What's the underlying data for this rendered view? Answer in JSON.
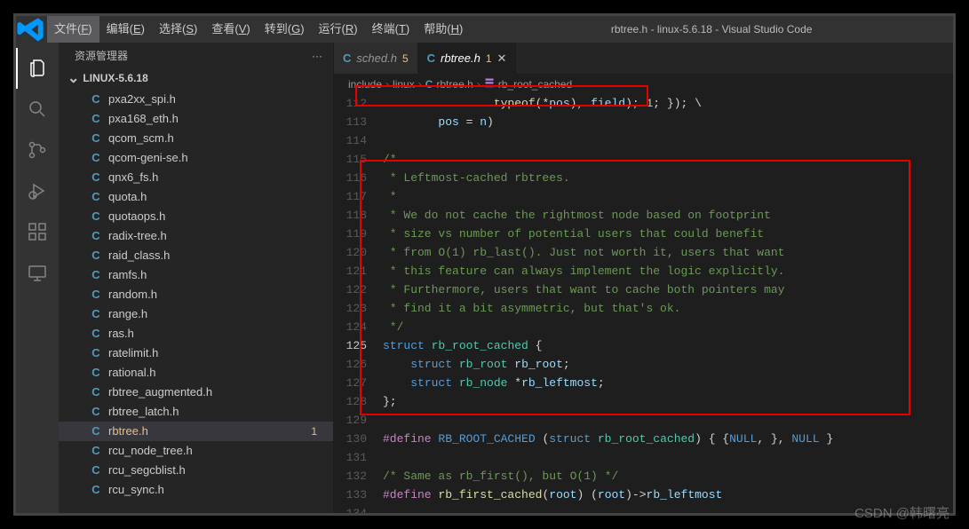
{
  "window_title": "rbtree.h - linux-5.6.18 - Visual Studio Code",
  "menubar": [
    {
      "label": "文件",
      "key": "F"
    },
    {
      "label": "编辑",
      "key": "E"
    },
    {
      "label": "选择",
      "key": "S"
    },
    {
      "label": "查看",
      "key": "V"
    },
    {
      "label": "转到",
      "key": "G"
    },
    {
      "label": "运行",
      "key": "R"
    },
    {
      "label": "终端",
      "key": "T"
    },
    {
      "label": "帮助",
      "key": "H"
    }
  ],
  "sidebar": {
    "title": "资源管理器",
    "folder": "LINUX-5.6.18",
    "more": "···",
    "files": [
      {
        "name": "pxa2xx_spi.h"
      },
      {
        "name": "pxa168_eth.h"
      },
      {
        "name": "qcom_scm.h"
      },
      {
        "name": "qcom-geni-se.h"
      },
      {
        "name": "qnx6_fs.h"
      },
      {
        "name": "quota.h"
      },
      {
        "name": "quotaops.h"
      },
      {
        "name": "radix-tree.h"
      },
      {
        "name": "raid_class.h"
      },
      {
        "name": "ramfs.h"
      },
      {
        "name": "random.h"
      },
      {
        "name": "range.h"
      },
      {
        "name": "ras.h"
      },
      {
        "name": "ratelimit.h"
      },
      {
        "name": "rational.h"
      },
      {
        "name": "rbtree_augmented.h"
      },
      {
        "name": "rbtree_latch.h"
      },
      {
        "name": "rbtree.h",
        "active": true,
        "badge": "1"
      },
      {
        "name": "rcu_node_tree.h"
      },
      {
        "name": "rcu_segcblist.h"
      },
      {
        "name": "rcu_sync.h"
      }
    ]
  },
  "tabs": [
    {
      "label": "sched.h",
      "badge": "5"
    },
    {
      "label": "rbtree.h",
      "badge": "1",
      "active": true
    }
  ],
  "breadcrumb": {
    "parts": [
      "include",
      "linux"
    ],
    "file": "rbtree.h",
    "symbol": "rb_root_cached"
  },
  "code": {
    "start": 112,
    "current": 125,
    "lines": [
      {
        "n": 112,
        "html": "                <span class='tok-func'>typeof</span>(*<span class='tok-var'>pos</span>), <span class='tok-var'>field</span>); <span class='tok-num'>1</span>; }); \\"
      },
      {
        "n": 113,
        "html": "        <span class='tok-var'>pos</span> = <span class='tok-var'>n</span>)"
      },
      {
        "n": 114,
        "html": ""
      },
      {
        "n": 115,
        "html": "<span class='tok-comment'>/*</span>"
      },
      {
        "n": 116,
        "html": "<span class='tok-comment'> * Leftmost-cached rbtrees.</span>"
      },
      {
        "n": 117,
        "html": "<span class='tok-comment'> *</span>"
      },
      {
        "n": 118,
        "html": "<span class='tok-comment'> * We do not cache the rightmost node based on footprint</span>"
      },
      {
        "n": 119,
        "html": "<span class='tok-comment'> * size vs number of potential users that could benefit</span>"
      },
      {
        "n": 120,
        "html": "<span class='tok-comment'> * from O(1) rb_last(). Just not worth it, users that want</span>"
      },
      {
        "n": 121,
        "html": "<span class='tok-comment'> * this feature can always implement the logic explicitly.</span>"
      },
      {
        "n": 122,
        "html": "<span class='tok-comment'> * Furthermore, users that want to cache both pointers may</span>"
      },
      {
        "n": 123,
        "html": "<span class='tok-comment'> * find it a bit asymmetric, but that's ok.</span>"
      },
      {
        "n": 124,
        "html": "<span class='tok-comment'> */</span>"
      },
      {
        "n": 125,
        "html": "<span class='tok-kw'>struct</span> <span class='tok-type'>rb_root_cached</span> {"
      },
      {
        "n": 126,
        "html": "    <span class='tok-kw'>struct</span> <span class='tok-type'>rb_root</span> <span class='tok-var'>rb_root</span>;"
      },
      {
        "n": 127,
        "html": "    <span class='tok-kw'>struct</span> <span class='tok-type'>rb_node</span> *<span class='tok-var'>rb_leftmost</span>;"
      },
      {
        "n": 128,
        "html": "};"
      },
      {
        "n": 129,
        "html": ""
      },
      {
        "n": 130,
        "html": "<span class='tok-macro'>#define</span> <span class='tok-macroname'>RB_ROOT_CACHED</span> (<span class='tok-kw'>struct</span> <span class='tok-type'>rb_root_cached</span>) { {<span class='tok-macroname'>NULL</span>, }, <span class='tok-macroname'>NULL</span> }"
      },
      {
        "n": 131,
        "html": ""
      },
      {
        "n": 132,
        "html": "<span class='tok-comment'>/* Same as rb_first(), but O(1) */</span>"
      },
      {
        "n": 133,
        "html": "<span class='tok-macro'>#define</span> <span class='tok-func'>rb_first_cached</span>(<span class='tok-var'>root</span>) (<span class='tok-var'>root</span>)-&gt;<span class='tok-var'>rb_leftmost</span>"
      },
      {
        "n": 134,
        "html": ""
      }
    ]
  },
  "watermark": "CSDN @韩曙亮"
}
